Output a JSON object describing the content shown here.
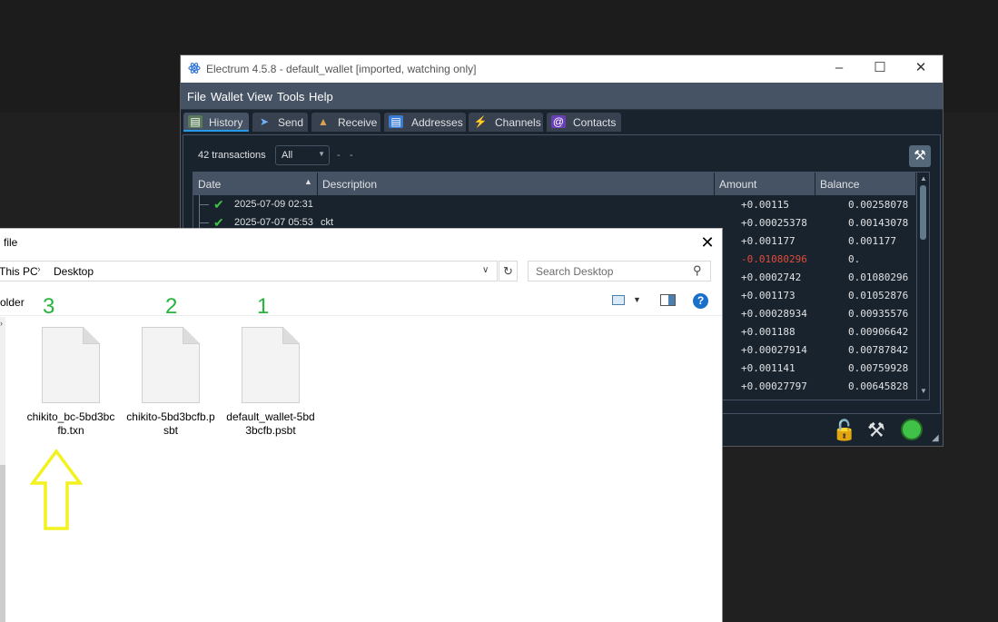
{
  "electrum": {
    "title": "Electrum 4.5.8  -  default_wallet  [imported, watching only]",
    "menu": [
      "File",
      "Wallet",
      "View",
      "Tools",
      "Help"
    ],
    "tabs": [
      "History",
      "Send",
      "Receive",
      "Addresses",
      "Channels",
      "Contacts"
    ],
    "tx_count": "42 transactions",
    "filter": "All",
    "date_range": [
      "-",
      "-"
    ],
    "columns": [
      "Date",
      "Description",
      "Amount",
      "Balance"
    ],
    "rows": [
      {
        "date": "2025-07-09 02:31",
        "desc": "",
        "amount": "+0.00115",
        "balance": "0.00258078",
        "negative": false
      },
      {
        "date": "2025-07-07 05:53",
        "desc": "ckt",
        "amount": "+0.00025378",
        "balance": "0.00143078",
        "negative": false
      },
      {
        "date": "",
        "desc": "",
        "amount": "+0.001177",
        "balance": "0.001177",
        "negative": false
      },
      {
        "date": "",
        "desc": "",
        "amount": "-0.01080296",
        "balance": "0.",
        "negative": true
      },
      {
        "date": "",
        "desc": "",
        "amount": "+0.0002742",
        "balance": "0.01080296",
        "negative": false
      },
      {
        "date": "",
        "desc": "",
        "amount": "+0.001173",
        "balance": "0.01052876",
        "negative": false
      },
      {
        "date": "",
        "desc": "",
        "amount": "+0.00028934",
        "balance": "0.00935576",
        "negative": false
      },
      {
        "date": "",
        "desc": "",
        "amount": "+0.001188",
        "balance": "0.00906642",
        "negative": false
      },
      {
        "date": "",
        "desc": "",
        "amount": "+0.00027914",
        "balance": "0.00787842",
        "negative": false
      },
      {
        "date": "",
        "desc": "",
        "amount": "+0.001141",
        "balance": "0.00759928",
        "negative": false
      },
      {
        "date": "",
        "desc": "",
        "amount": "+0.00027797",
        "balance": "0.00645828",
        "negative": false
      }
    ],
    "colors": {
      "bg": "#19232d",
      "panel": "#455364",
      "positive": "#e0e1e3",
      "negative": "#e14b3b",
      "status_ok": "#3fc247"
    }
  },
  "dialog": {
    "title": "file",
    "breadcrumb": [
      "This PC",
      "Desktop"
    ],
    "search_placeholder": "Search Desktop",
    "new_folder": "older",
    "files": [
      {
        "name": "chikito_bc-5bd3bcfb.txn",
        "label": "3"
      },
      {
        "name": "chikito-5bd3bcfb.psbt",
        "label": "2"
      },
      {
        "name": "default_wallet-5bd3bcfb.psbt",
        "label": "1"
      }
    ],
    "annotation_color": "#27b33c",
    "arrow_color": "#f2f21e"
  }
}
